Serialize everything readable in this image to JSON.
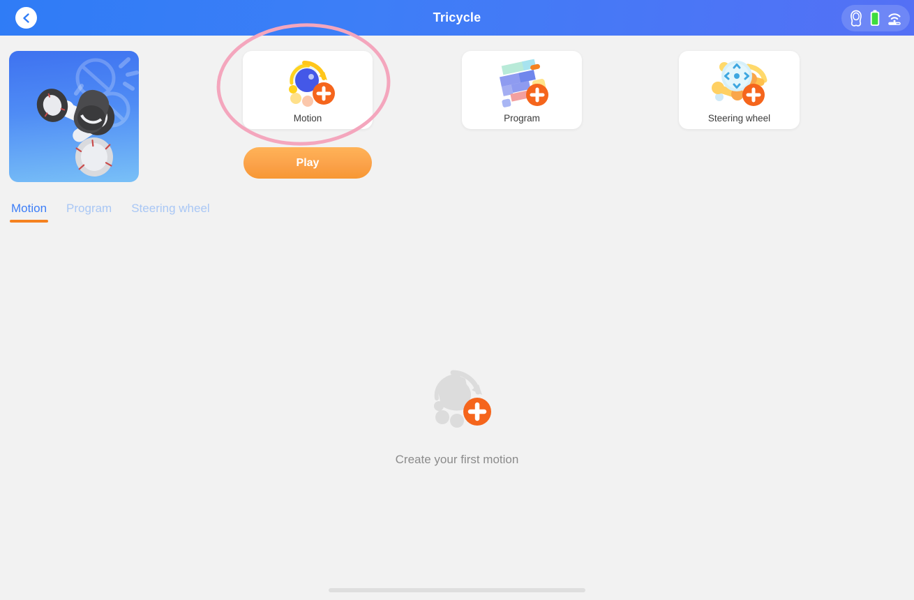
{
  "header": {
    "title": "Tricycle",
    "back_icon": "chevron-left-icon",
    "status_icons": [
      "robot-head-icon",
      "battery-icon",
      "wifi-router-icon"
    ],
    "battery_color": "#3ddc3d",
    "gradient_from": "#2f7cf6",
    "gradient_to": "#5470f5"
  },
  "robot_preview": {
    "name": "tricycle-robot-thumbnail",
    "gradient_from": "#3e72f0",
    "gradient_to": "#79c0f7"
  },
  "tiles": [
    {
      "id": "motion",
      "label": "Motion",
      "icon": "motion-add-icon"
    },
    {
      "id": "program",
      "label": "Program",
      "icon": "program-add-icon"
    },
    {
      "id": "wheel",
      "label": "Steering wheel",
      "icon": "steering-wheel-add-icon"
    }
  ],
  "play": {
    "label": "Play",
    "color": "#fba24a"
  },
  "annotation": {
    "shape": "ellipse",
    "color": "#f4a6bd",
    "target": "motion"
  },
  "tabs": [
    {
      "id": "motion",
      "label": "Motion",
      "active": true
    },
    {
      "id": "program",
      "label": "Program",
      "active": false
    },
    {
      "id": "wheel",
      "label": "Steering wheel",
      "active": false
    }
  ],
  "tab_colors": {
    "active": "#3d7ef7",
    "inactive": "#a9c7f5",
    "underline": "#f58220"
  },
  "empty_state": {
    "text": "Create your first motion",
    "icon": "motion-add-placeholder-icon",
    "text_color": "#8b8b8b"
  },
  "background_color": "#f2f2f2"
}
